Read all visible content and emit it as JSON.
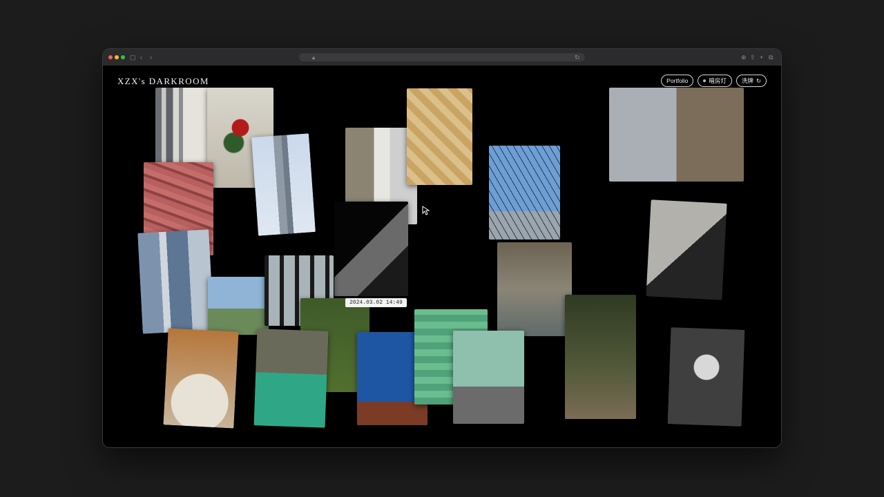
{
  "site": {
    "title": "XZX's DARKROOM"
  },
  "nav": {
    "portfolio_label": "Portfolio",
    "darkroom_light_label": "暗房灯",
    "shuffle_label": "洗牌"
  },
  "tooltip": {
    "timestamp": "2024.03.02 14:49"
  },
  "icons": {
    "shuffle": "refresh-icon",
    "light_indicator": "dot-icon",
    "lock": "lock-icon",
    "reload": "reload-icon"
  },
  "colors": {
    "page_background": "#000000",
    "text": "#f2f2f2",
    "traffic_red": "#ff5f57",
    "traffic_yellow": "#febc2e",
    "traffic_green": "#28c840"
  },
  "photos": [
    "striped-wall-photo",
    "red-flowers-photo",
    "pink-wall-photo",
    "tower-sky-photo",
    "building-window-photo",
    "yellow-tiles-photo",
    "blue-sky-fence-photo",
    "concrete-stairs-photo",
    "shadow-wall-photo",
    "glass-building-photo",
    "lake-shore-photo",
    "window-frame-photo",
    "grass-photo",
    "rocks-water-photo",
    "fruit-plate-photo",
    "river-photo",
    "blue-door-photo",
    "green-tiles-photo",
    "beach-photo",
    "can-photo",
    "stone-graffiti-photo",
    "sign-frame-photo"
  ]
}
